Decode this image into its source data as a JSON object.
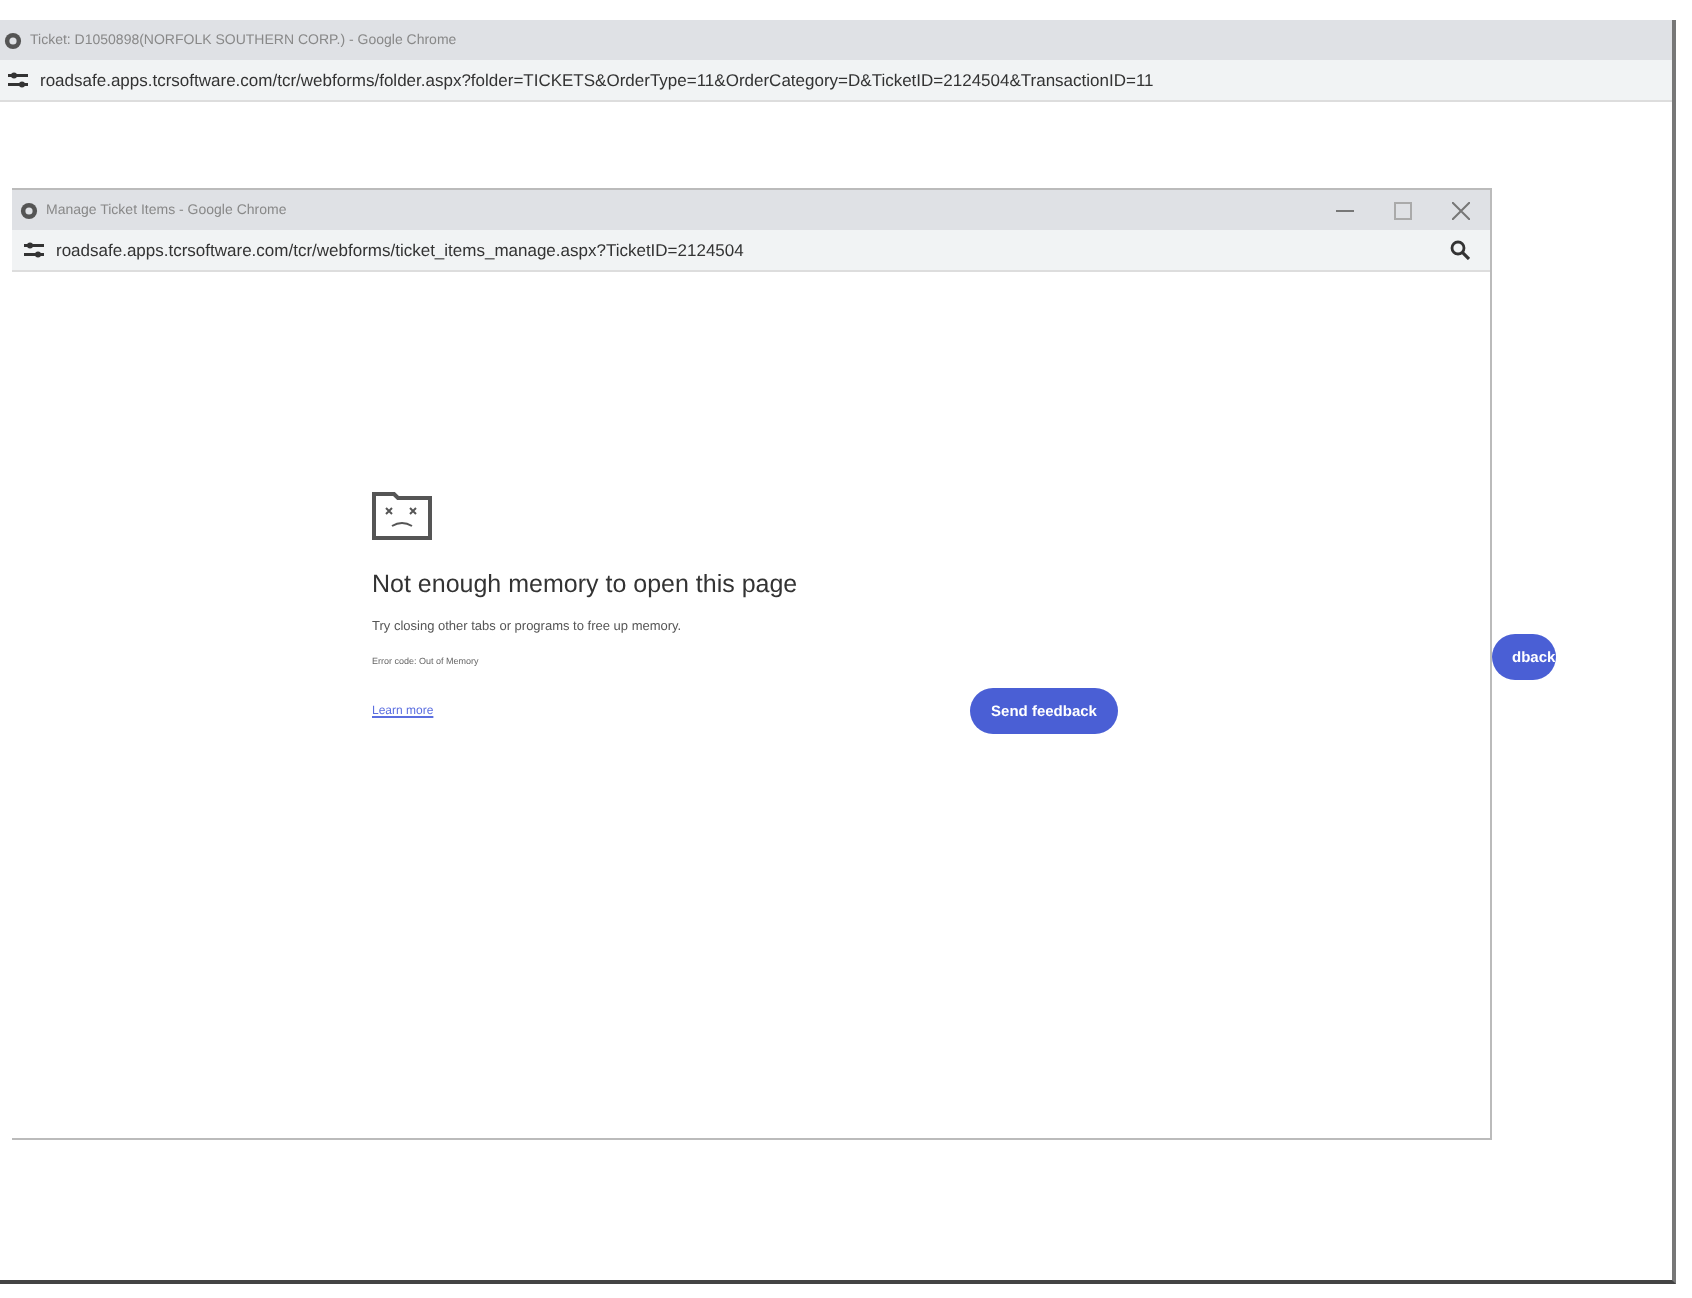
{
  "back_window": {
    "title": "Ticket: D1050898(NORFOLK SOUTHERN CORP.) - Google Chrome",
    "url": "roadsafe.apps.tcrsoftware.com/tcr/webforms/folder.aspx?folder=TICKETS&OrderType=11&OrderCategory=D&TicketID=2124504&TransactionID=11",
    "button_fragment": "dback"
  },
  "front_window": {
    "title": "Manage Ticket Items - Google Chrome",
    "url": "roadsafe.apps.tcrsoftware.com/tcr/webforms/ticket_items_manage.aspx?TicketID=2124504",
    "error": {
      "heading": "Not enough memory to open this page",
      "message": "Try closing other tabs or programs to free up memory.",
      "code": "Error code: Out of Memory",
      "link": "Learn more",
      "button": "Send feedback"
    }
  }
}
